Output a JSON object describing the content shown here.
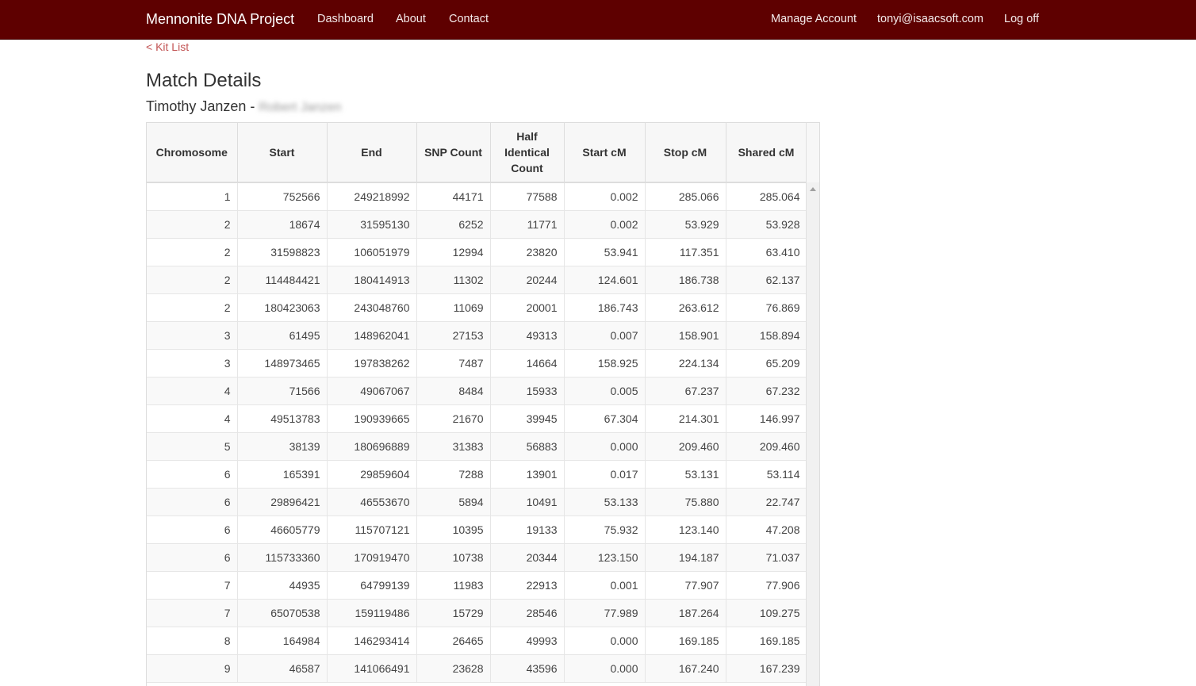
{
  "nav": {
    "brand": "Mennonite DNA Project",
    "links": [
      "Dashboard",
      "About",
      "Contact"
    ],
    "right_links": [
      "Manage Account",
      "tonyi@isaacsoft.com",
      "Log off"
    ],
    "bar_color": "#5e0000"
  },
  "back_link": "< Kit List",
  "page_title": "Match Details",
  "subtitle": {
    "name": "Timothy Janzen",
    "separator": " - ",
    "blurred_name": "Robert Janzen"
  },
  "table": {
    "headers": [
      "Chromosome",
      "Start",
      "End",
      "SNP Count",
      "Half Identical Count",
      "Start cM",
      "Stop cM",
      "Shared cM"
    ],
    "rows": [
      [
        "1",
        "752566",
        "249218992",
        "44171",
        "77588",
        "0.002",
        "285.066",
        "285.064"
      ],
      [
        "2",
        "18674",
        "31595130",
        "6252",
        "11771",
        "0.002",
        "53.929",
        "53.928"
      ],
      [
        "2",
        "31598823",
        "106051979",
        "12994",
        "23820",
        "53.941",
        "117.351",
        "63.410"
      ],
      [
        "2",
        "114484421",
        "180414913",
        "11302",
        "20244",
        "124.601",
        "186.738",
        "62.137"
      ],
      [
        "2",
        "180423063",
        "243048760",
        "11069",
        "20001",
        "186.743",
        "263.612",
        "76.869"
      ],
      [
        "3",
        "61495",
        "148962041",
        "27153",
        "49313",
        "0.007",
        "158.901",
        "158.894"
      ],
      [
        "3",
        "148973465",
        "197838262",
        "7487",
        "14664",
        "158.925",
        "224.134",
        "65.209"
      ],
      [
        "4",
        "71566",
        "49067067",
        "8484",
        "15933",
        "0.005",
        "67.237",
        "67.232"
      ],
      [
        "4",
        "49513783",
        "190939665",
        "21670",
        "39945",
        "67.304",
        "214.301",
        "146.997"
      ],
      [
        "5",
        "38139",
        "180696889",
        "31383",
        "56883",
        "0.000",
        "209.460",
        "209.460"
      ],
      [
        "6",
        "165391",
        "29859604",
        "7288",
        "13901",
        "0.017",
        "53.131",
        "53.114"
      ],
      [
        "6",
        "29896421",
        "46553670",
        "5894",
        "10491",
        "53.133",
        "75.880",
        "22.747"
      ],
      [
        "6",
        "46605779",
        "115707121",
        "10395",
        "19133",
        "75.932",
        "123.140",
        "47.208"
      ],
      [
        "6",
        "115733360",
        "170919470",
        "10738",
        "20344",
        "123.150",
        "194.187",
        "71.037"
      ],
      [
        "7",
        "44935",
        "64799139",
        "11983",
        "22913",
        "0.001",
        "77.907",
        "77.906"
      ],
      [
        "7",
        "65070538",
        "159119486",
        "15729",
        "28546",
        "77.989",
        "187.264",
        "109.275"
      ],
      [
        "8",
        "164984",
        "146293414",
        "26465",
        "49993",
        "0.000",
        "169.185",
        "169.185"
      ],
      [
        "9",
        "46587",
        "141066491",
        "23628",
        "43596",
        "0.000",
        "167.240",
        "167.239"
      ]
    ]
  }
}
